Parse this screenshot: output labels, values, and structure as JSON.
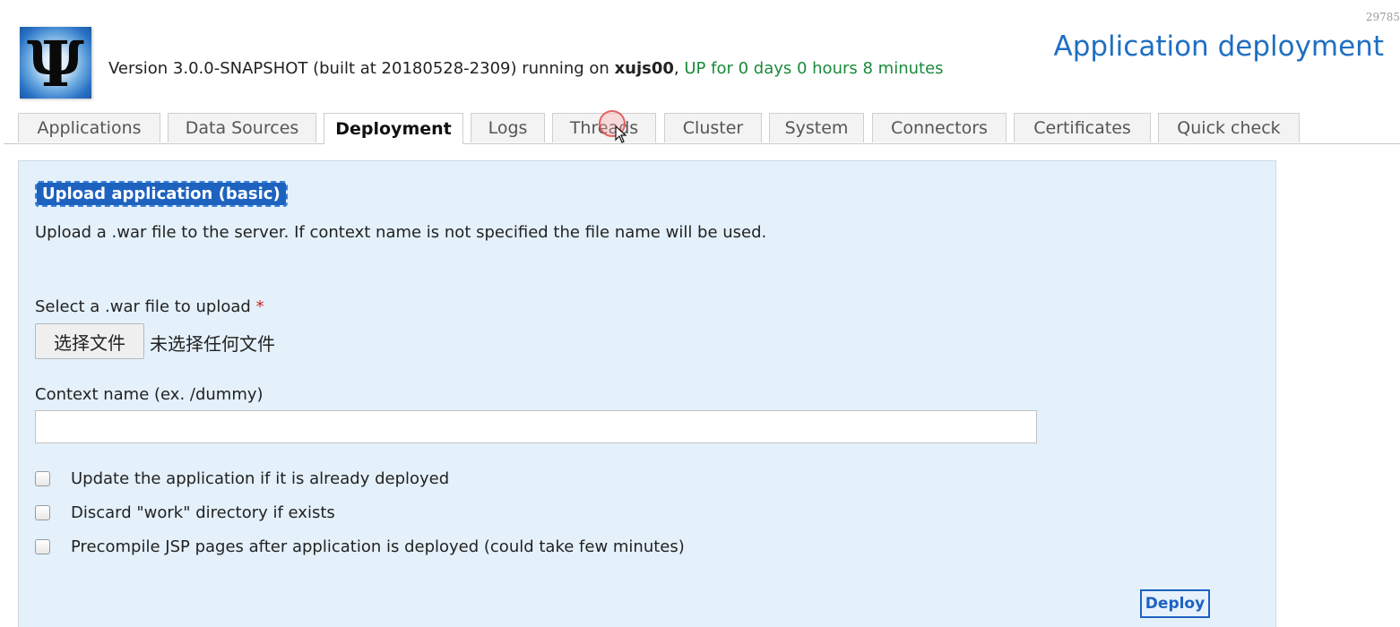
{
  "corner_number": "29785",
  "header": {
    "version_prefix": "Version 3.0.0-SNAPSHOT (built at 20180528-2309) running on ",
    "host": "xujs00",
    "separator": ", ",
    "uptime": "UP for 0 days 0 hours 8 minutes",
    "page_title": "Application deployment"
  },
  "tabs": [
    {
      "label": "Applications"
    },
    {
      "label": "Data Sources"
    },
    {
      "label": "Deployment",
      "active": true
    },
    {
      "label": "Logs"
    },
    {
      "label": "Threads"
    },
    {
      "label": "Cluster"
    },
    {
      "label": "System"
    },
    {
      "label": "Connectors"
    },
    {
      "label": "Certificates"
    },
    {
      "label": "Quick check"
    }
  ],
  "upload": {
    "heading": "Upload application (basic)",
    "description": "Upload a .war file to the server. If context name is not specified the file name will be used.",
    "file_label": "Select a .war file to upload",
    "required_mark": "*",
    "file_button": "选择文件",
    "file_status": "未选择任何文件",
    "context_label": "Context name (ex. /dummy)",
    "context_value": "",
    "options": [
      {
        "label": "Update the application if it is already deployed",
        "checked": false
      },
      {
        "label": "Discard \"work\" directory if exists",
        "checked": false
      },
      {
        "label": "Precompile JSP pages after application is deployed (could take few minutes)",
        "checked": false
      }
    ],
    "deploy_button": "Deploy"
  },
  "colors": {
    "accent": "#1e62c0",
    "title": "#1f6fc2",
    "uptime": "#1a8a3a",
    "panel_bg": "#e4f1fb",
    "required": "#d02020"
  },
  "icons": {
    "logo": "psi-logo-icon",
    "cursor": "mouse-cursor-icon"
  }
}
